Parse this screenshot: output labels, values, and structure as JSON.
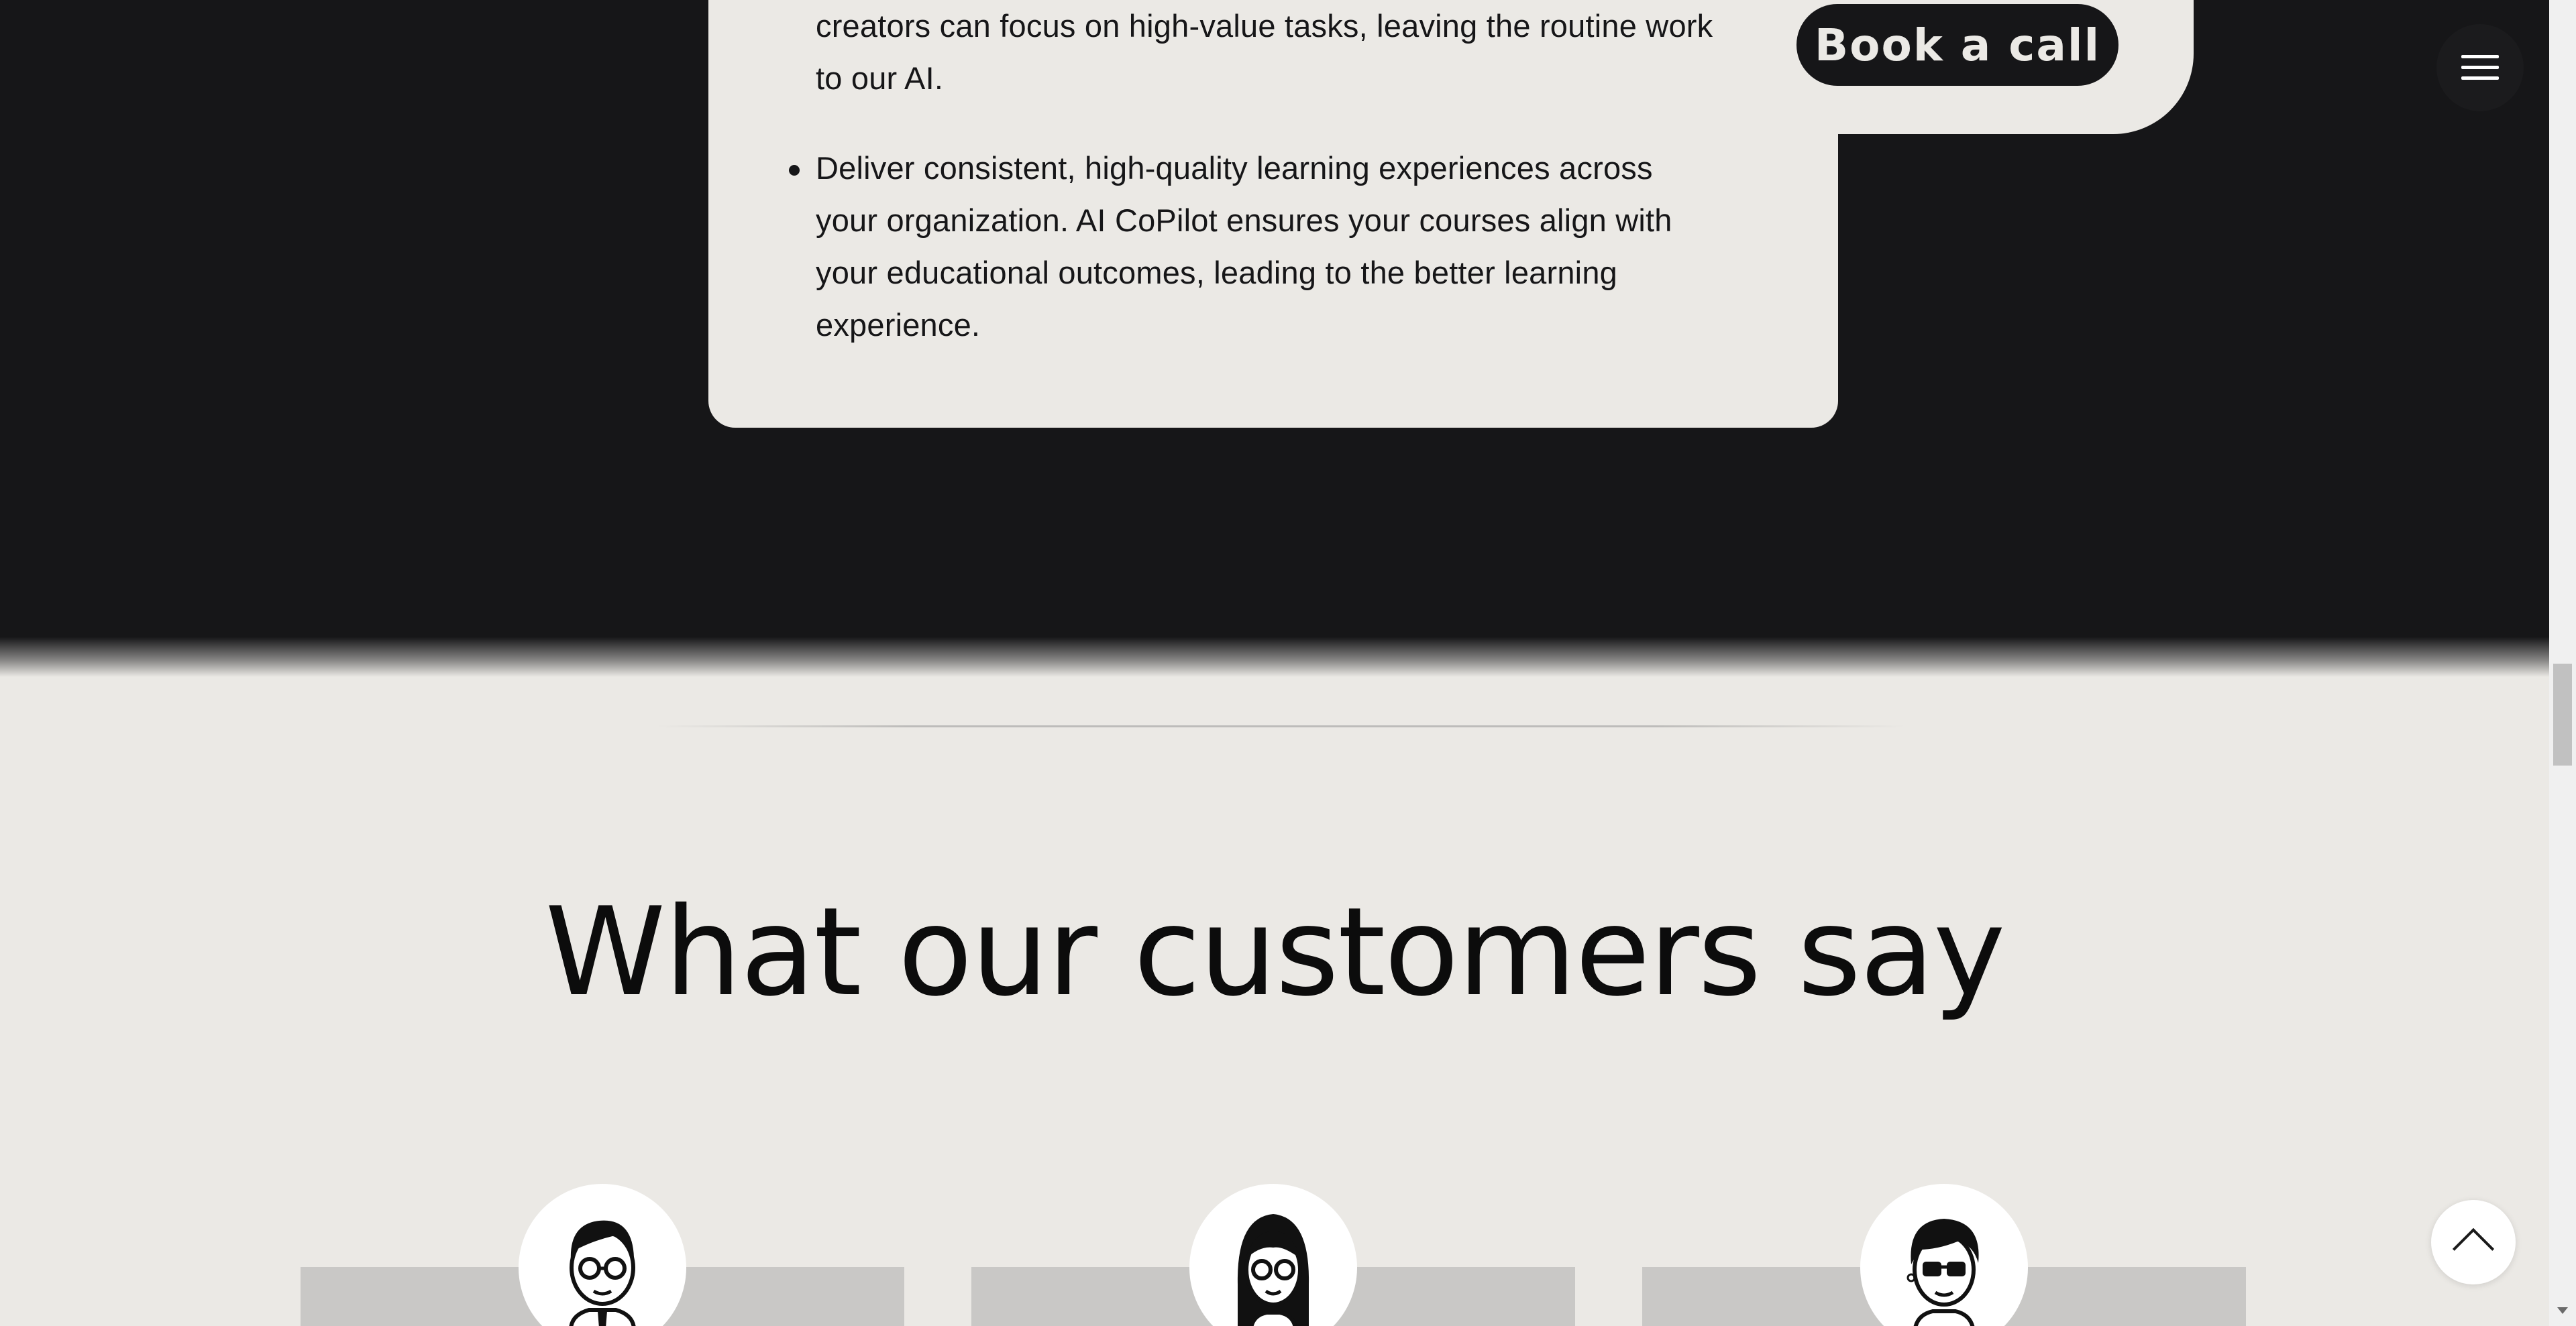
{
  "info_card": {
    "bullets": [
      {
        "lines_visible": [
          "creators can focus on high-value tasks, leaving the routine work",
          "to our AI."
        ]
      },
      {
        "lines_visible": [
          "Deliver consistent, high-quality learning experiences across",
          "your organization. AI CoPilot ensures your courses align with",
          "your educational outcomes, leading to the better learning",
          "experience."
        ]
      }
    ]
  },
  "header": {
    "cta_label": "Book a call",
    "menu_icon": "hamburger-menu-icon"
  },
  "testimonials": {
    "heading": "What our customers say",
    "avatars": [
      "man-with-glasses-avatar",
      "woman-with-long-hair-avatar",
      "person-with-glasses-avatar"
    ]
  },
  "controls": {
    "scroll_top_icon": "chevron-up-icon"
  },
  "colors": {
    "dark_bg": "#161618",
    "cream_bg": "#ebe9e5",
    "card_gray": "#c9c8c6",
    "text": "#161618"
  }
}
